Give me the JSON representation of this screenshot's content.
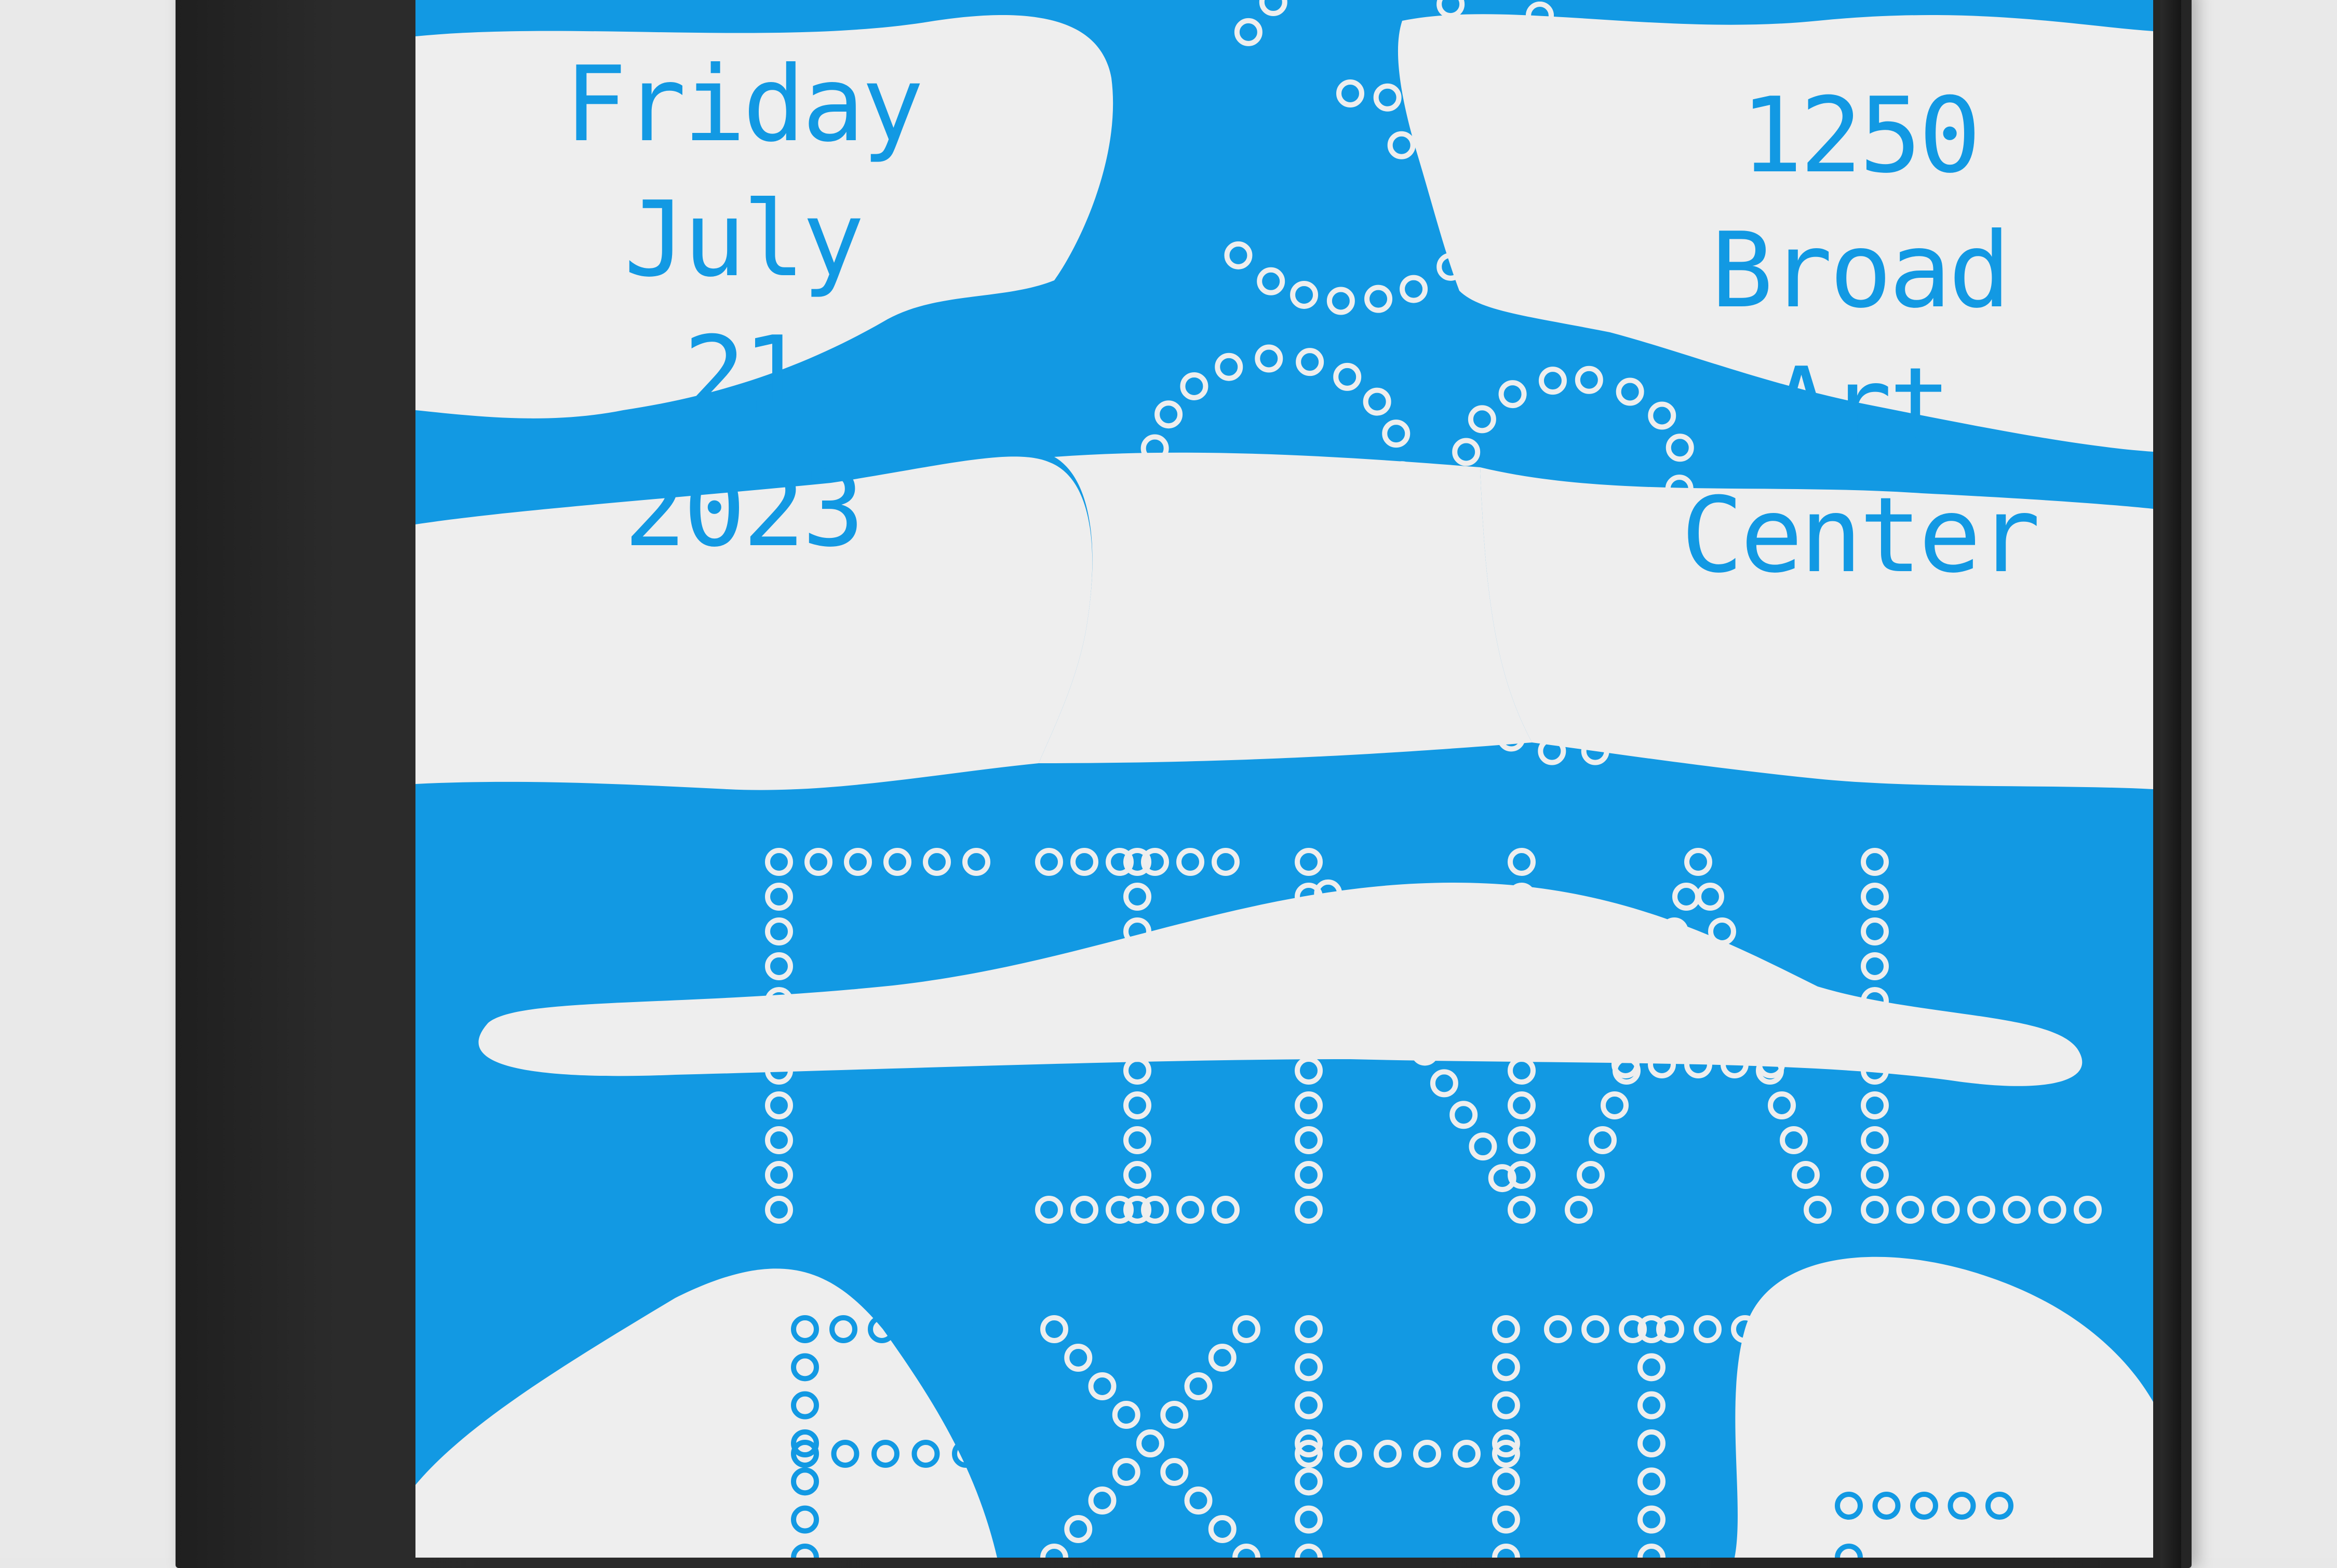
{
  "poster": {
    "date_lines": [
      "Friday",
      "July",
      "21",
      "2023"
    ],
    "venue_lines": [
      "1250",
      "Broad",
      "Art",
      "Center"
    ],
    "year_code": "23",
    "headline": "FINAL",
    "subhead_partial": "EXHIB"
  },
  "colors": {
    "poster_blue": "#1299e3",
    "poster_white": "#eeeeee",
    "frame": "#242424",
    "background": "#e9e9e9"
  }
}
